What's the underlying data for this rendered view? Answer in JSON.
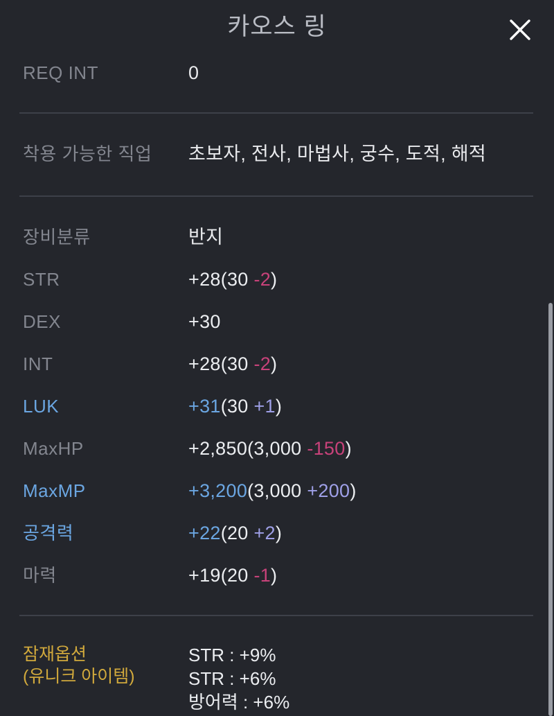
{
  "header": {
    "title": "카오스 링",
    "close_icon": "close-icon"
  },
  "colors": {
    "background": "#24262c",
    "divider": "#3d4049",
    "label_dim": "#83868f",
    "label_blue": "#6ba6e2",
    "value_white": "#eceef1",
    "delta_positive": "#9fa0e8",
    "delta_negative": "#c8427a",
    "potential_label": "#d1a93c",
    "scrollbar": "#9a9da4"
  },
  "requirement": {
    "label": "REQ INT",
    "value": "0"
  },
  "jobs": {
    "label": "착용 가능한 직업",
    "value": "초보자, 전사, 마법사, 궁수, 도적, 해적"
  },
  "category": {
    "label": "장비분류",
    "value": "반지"
  },
  "stats": [
    {
      "label": "STR",
      "label_highlight": false,
      "total": "+28",
      "total_highlight": false,
      "open": "(30 ",
      "delta": "-2",
      "delta_sign": "negative",
      "close": ")"
    },
    {
      "label": "DEX",
      "label_highlight": false,
      "total": "+30",
      "total_highlight": false,
      "open": "",
      "delta": "",
      "delta_sign": "none",
      "close": ""
    },
    {
      "label": "INT",
      "label_highlight": false,
      "total": "+28",
      "total_highlight": false,
      "open": "(30 ",
      "delta": "-2",
      "delta_sign": "negative",
      "close": ")"
    },
    {
      "label": "LUK",
      "label_highlight": true,
      "total": "+31",
      "total_highlight": true,
      "open": "(30 ",
      "delta": "+1",
      "delta_sign": "positive",
      "close": ")"
    },
    {
      "label": "MaxHP",
      "label_highlight": false,
      "total": "+2,850",
      "total_highlight": false,
      "open": "(3,000 ",
      "delta": "-150",
      "delta_sign": "negative",
      "close": ")"
    },
    {
      "label": "MaxMP",
      "label_highlight": true,
      "total": "+3,200",
      "total_highlight": true,
      "open": "(3,000 ",
      "delta": "+200",
      "delta_sign": "positive",
      "close": ")"
    },
    {
      "label": "공격력",
      "label_highlight": true,
      "total": "+22",
      "total_highlight": true,
      "open": "(20 ",
      "delta": "+2",
      "delta_sign": "positive",
      "close": ")"
    },
    {
      "label": "마력",
      "label_highlight": false,
      "total": "+19",
      "total_highlight": false,
      "open": "(20 ",
      "delta": "-1",
      "delta_sign": "negative",
      "close": ")"
    }
  ],
  "potential": {
    "label_line1": "잠재옵션",
    "label_line2": "(유니크 아이템)",
    "options": [
      "STR : +9%",
      "STR : +6%",
      "방어력 : +6%"
    ]
  },
  "scrollbar": {
    "orientation": "vertical",
    "thumb_position": "bottom"
  }
}
